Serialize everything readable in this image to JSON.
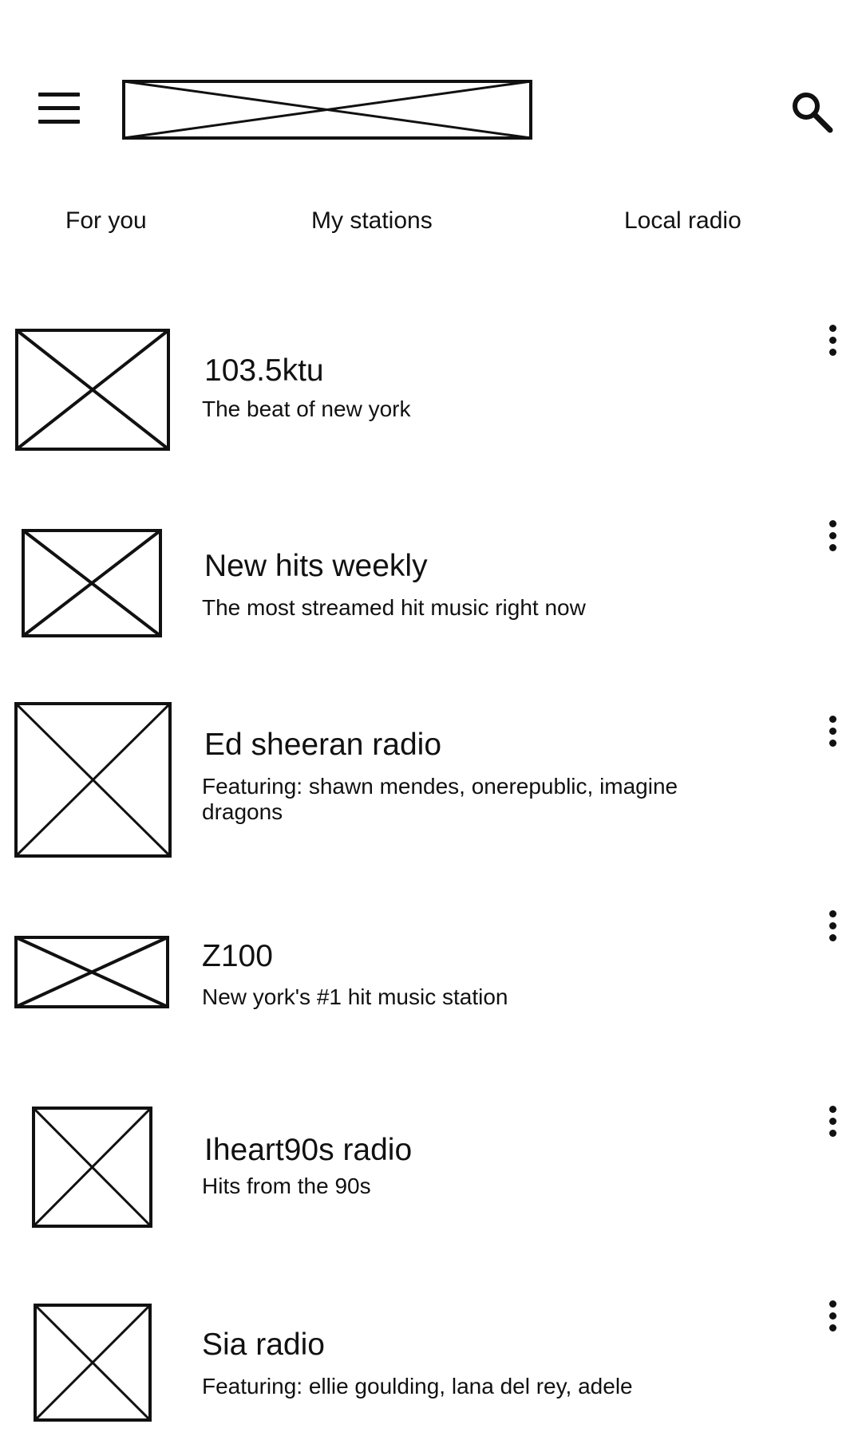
{
  "header": {
    "menu_icon": "hamburger-menu-icon",
    "logo": "image-placeholder",
    "search_icon": "search-icon"
  },
  "tabs": [
    {
      "label": "For you"
    },
    {
      "label": "My stations"
    },
    {
      "label": "Local radio"
    }
  ],
  "stations": [
    {
      "title": "103.5ktu",
      "subtitle": "The beat of new york"
    },
    {
      "title": "New hits weekly",
      "subtitle": "The most streamed hit music right now"
    },
    {
      "title": "Ed sheeran radio",
      "subtitle": "Featuring: shawn mendes, onerepublic, imagine dragons"
    },
    {
      "title": "Z100",
      "subtitle": "New york's #1 hit music station"
    },
    {
      "title": "Iheart90s radio",
      "subtitle": "Hits from the 90s"
    },
    {
      "title": "Sia radio",
      "subtitle": "Featuring: ellie goulding, lana del rey, adele"
    }
  ],
  "colors": {
    "foreground": "#111111",
    "background": "#ffffff"
  }
}
